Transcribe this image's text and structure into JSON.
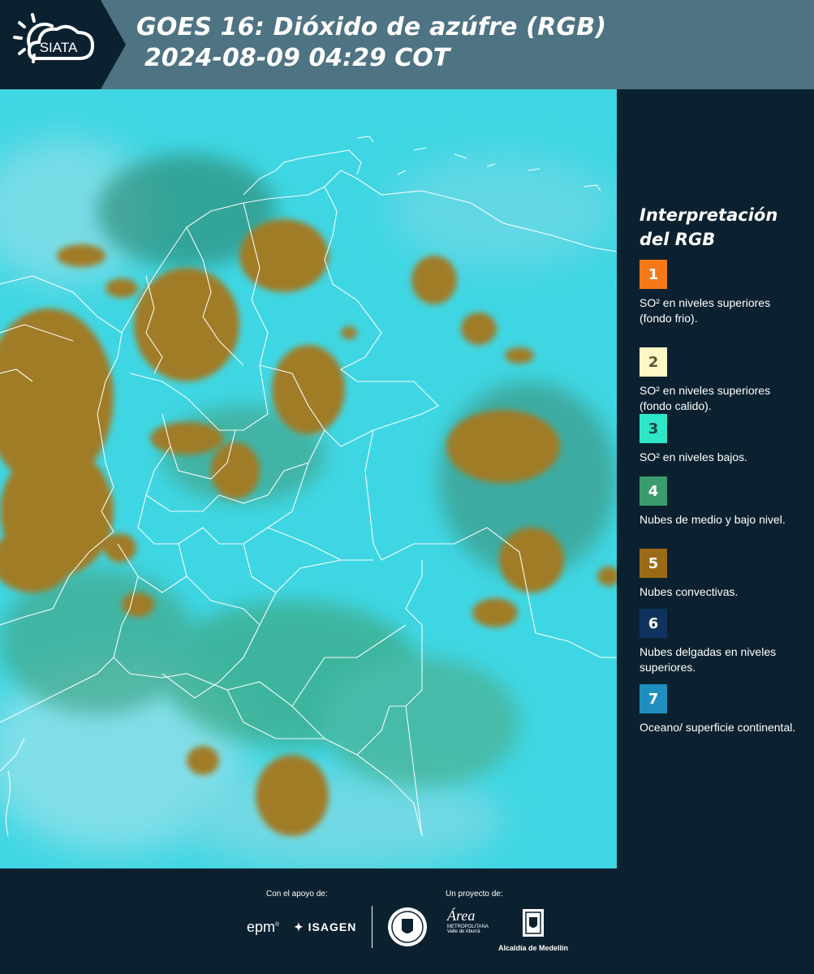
{
  "header": {
    "logo_text": "SIATA",
    "title_line1": "GOES 16: Dióxido de azúfre (RGB)",
    "title_line2": "2024-08-09 04:29 COT"
  },
  "legend": {
    "title_line1": "Interpretación",
    "title_line2": "del RGB",
    "items": [
      {
        "number": "1",
        "color": "#f57a17",
        "text_color": "#ffffff",
        "label": "SO² en niveles superiores (fondo frio)."
      },
      {
        "number": "2",
        "color": "#fff7c4",
        "text_color": "#5a5a3a",
        "label": "SO² en niveles superiores (fondo calido)."
      },
      {
        "number": "3",
        "color": "#2ee6c8",
        "text_color": "#1a4a44",
        "label": "SO² en niveles bajos."
      },
      {
        "number": "4",
        "color": "#3a9c6c",
        "text_color": "#ffffff",
        "label": "Nubes de medio y bajo nivel."
      },
      {
        "number": "5",
        "color": "#9b6a16",
        "text_color": "#ffffff",
        "label": "Nubes convectivas."
      },
      {
        "number": "6",
        "color": "#10335e",
        "text_color": "#ffffff",
        "label": "Nubes delgadas en niveles superiores."
      },
      {
        "number": "7",
        "color": "#1f8fbf",
        "text_color": "#ffffff",
        "label": "Oceano/ superficie continental."
      }
    ]
  },
  "footer": {
    "support_label": "Con el apoyo de:",
    "project_label": "Un proyecto de:",
    "epm": "epm",
    "isagen": "ISAGEN",
    "area_title": "Área",
    "area_sub1": "METROPOLITANA",
    "area_sub2": "Valle de Aburrá",
    "alcaldia": "Alcaldía de Medellín"
  },
  "colors": {
    "header_bg": "#4e7383",
    "panel_bg": "#0c2130",
    "map_cyan": "#3fd6e3",
    "cloud_brown": "#a07c28"
  }
}
